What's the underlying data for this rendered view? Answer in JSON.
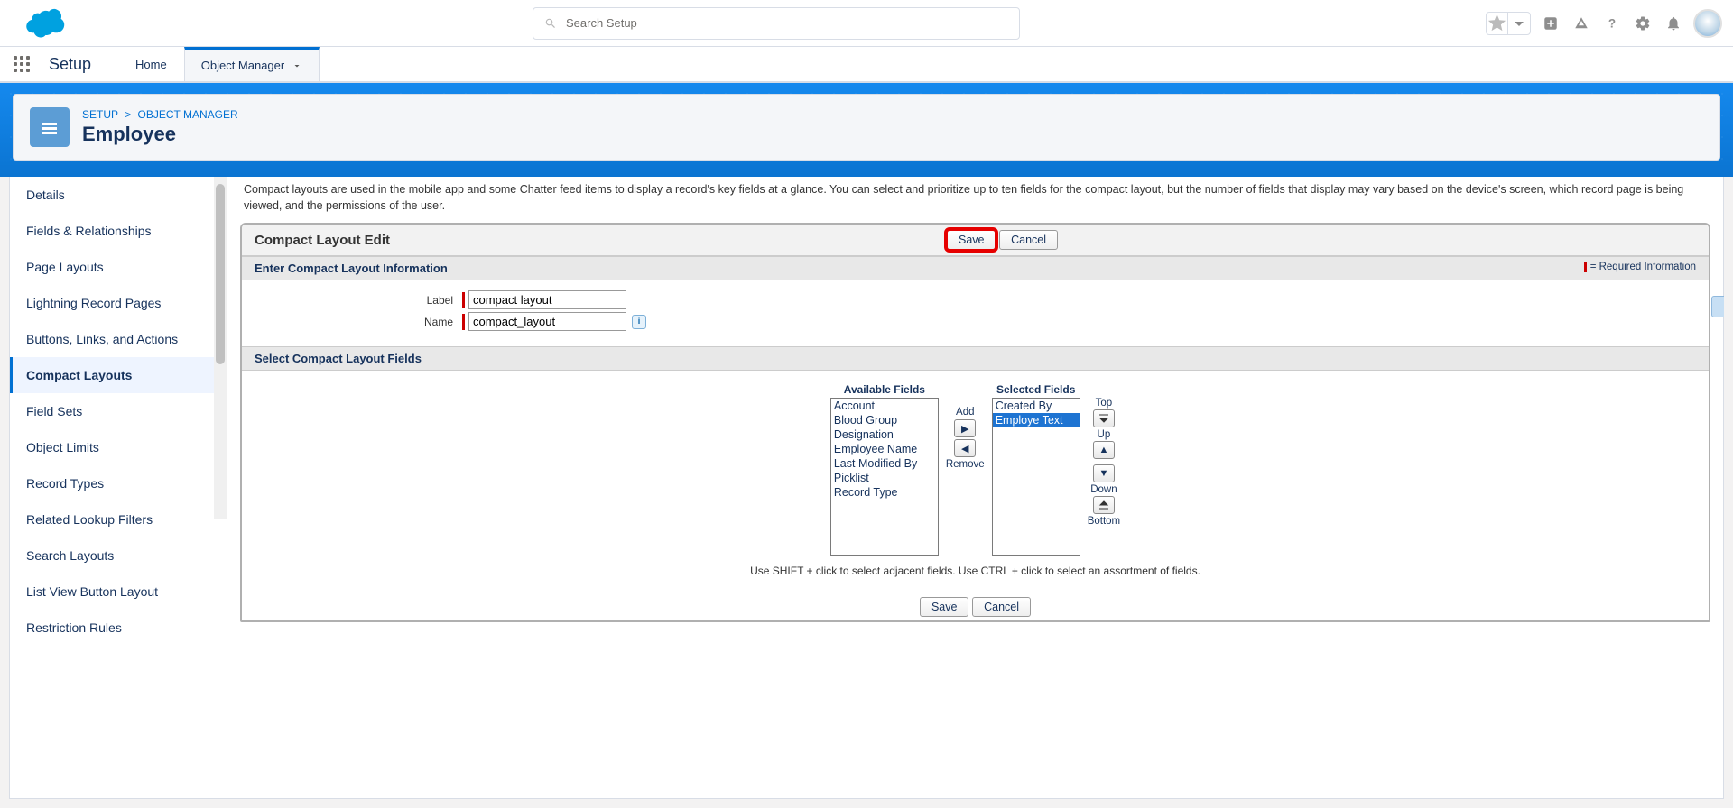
{
  "header": {
    "search_placeholder": "Search Setup"
  },
  "contextBar": {
    "appName": "Setup",
    "tabs": [
      {
        "label": "Home",
        "active": false
      },
      {
        "label": "Object Manager",
        "active": true,
        "hasDropdown": true
      }
    ]
  },
  "pageHeader": {
    "breadcrumb": [
      "SETUP",
      "OBJECT MANAGER"
    ],
    "title": "Employee"
  },
  "sidebar": {
    "items": [
      {
        "label": "Details"
      },
      {
        "label": "Fields & Relationships"
      },
      {
        "label": "Page Layouts"
      },
      {
        "label": "Lightning Record Pages"
      },
      {
        "label": "Buttons, Links, and Actions"
      },
      {
        "label": "Compact Layouts",
        "active": true
      },
      {
        "label": "Field Sets"
      },
      {
        "label": "Object Limits"
      },
      {
        "label": "Record Types"
      },
      {
        "label": "Related Lookup Filters"
      },
      {
        "label": "Search Layouts"
      },
      {
        "label": "List View Button Layout"
      },
      {
        "label": "Restriction Rules"
      }
    ]
  },
  "content": {
    "help_text": "Compact layouts are used in the mobile app and some Chatter feed items to display a record's key fields at a glance. You can select and prioritize up to ten fields for the compact layout, but the number of fields that display may vary based on the device's screen, which record page is being viewed, and the permissions of the user.",
    "panel_title": "Compact Layout Edit",
    "save_label": "Save",
    "cancel_label": "Cancel",
    "section_info": "Enter Compact Layout Information",
    "required_legend": "= Required Information",
    "label_label": "Label",
    "label_value": "compact layout",
    "name_label": "Name",
    "name_value": "compact_layout",
    "section_fields": "Select Compact Layout Fields",
    "available_label": "Available Fields",
    "selected_label": "Selected Fields",
    "available_fields": [
      "Account",
      "Blood Group",
      "Designation",
      "Employee Name",
      "Last Modified By",
      "Picklist",
      "Record Type"
    ],
    "selected_fields": [
      {
        "label": "Created By",
        "selected": false
      },
      {
        "label": "Employe Text",
        "selected": true
      }
    ],
    "add_label": "Add",
    "remove_label": "Remove",
    "top_label": "Top",
    "up_label": "Up",
    "down_label": "Down",
    "bottom_label": "Bottom",
    "hint": "Use SHIFT + click to select adjacent fields. Use CTRL + click to select an assortment of fields.",
    "info_char": "i"
  }
}
